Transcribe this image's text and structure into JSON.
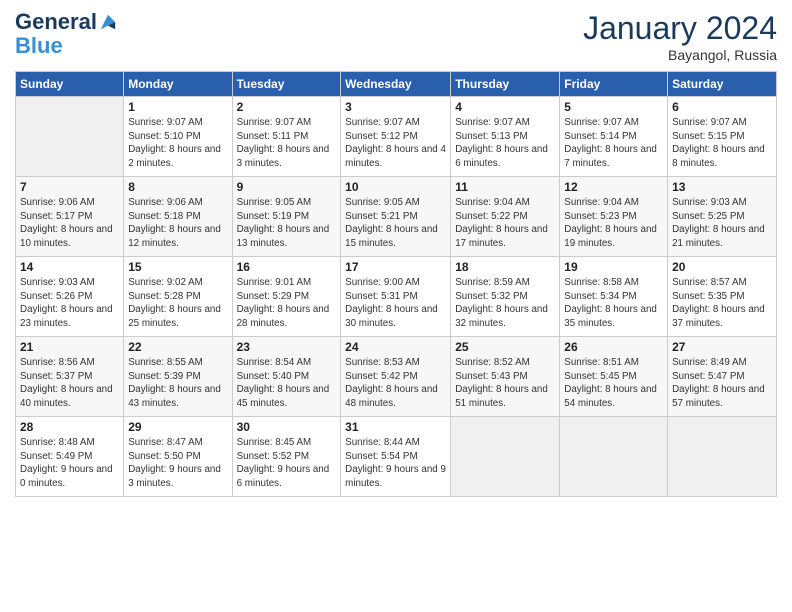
{
  "logo": {
    "line1": "General",
    "line2": "Blue"
  },
  "title": "January 2024",
  "subtitle": "Bayangol, Russia",
  "weekdays": [
    "Sunday",
    "Monday",
    "Tuesday",
    "Wednesday",
    "Thursday",
    "Friday",
    "Saturday"
  ],
  "weeks": [
    [
      {
        "day": null
      },
      {
        "day": 1,
        "sunrise": "9:07 AM",
        "sunset": "5:10 PM",
        "daylight": "8 hours and 2 minutes."
      },
      {
        "day": 2,
        "sunrise": "9:07 AM",
        "sunset": "5:11 PM",
        "daylight": "8 hours and 3 minutes."
      },
      {
        "day": 3,
        "sunrise": "9:07 AM",
        "sunset": "5:12 PM",
        "daylight": "8 hours and 4 minutes."
      },
      {
        "day": 4,
        "sunrise": "9:07 AM",
        "sunset": "5:13 PM",
        "daylight": "8 hours and 6 minutes."
      },
      {
        "day": 5,
        "sunrise": "9:07 AM",
        "sunset": "5:14 PM",
        "daylight": "8 hours and 7 minutes."
      },
      {
        "day": 6,
        "sunrise": "9:07 AM",
        "sunset": "5:15 PM",
        "daylight": "8 hours and 8 minutes."
      }
    ],
    [
      {
        "day": 7,
        "sunrise": "9:06 AM",
        "sunset": "5:17 PM",
        "daylight": "8 hours and 10 minutes."
      },
      {
        "day": 8,
        "sunrise": "9:06 AM",
        "sunset": "5:18 PM",
        "daylight": "8 hours and 12 minutes."
      },
      {
        "day": 9,
        "sunrise": "9:05 AM",
        "sunset": "5:19 PM",
        "daylight": "8 hours and 13 minutes."
      },
      {
        "day": 10,
        "sunrise": "9:05 AM",
        "sunset": "5:21 PM",
        "daylight": "8 hours and 15 minutes."
      },
      {
        "day": 11,
        "sunrise": "9:04 AM",
        "sunset": "5:22 PM",
        "daylight": "8 hours and 17 minutes."
      },
      {
        "day": 12,
        "sunrise": "9:04 AM",
        "sunset": "5:23 PM",
        "daylight": "8 hours and 19 minutes."
      },
      {
        "day": 13,
        "sunrise": "9:03 AM",
        "sunset": "5:25 PM",
        "daylight": "8 hours and 21 minutes."
      }
    ],
    [
      {
        "day": 14,
        "sunrise": "9:03 AM",
        "sunset": "5:26 PM",
        "daylight": "8 hours and 23 minutes."
      },
      {
        "day": 15,
        "sunrise": "9:02 AM",
        "sunset": "5:28 PM",
        "daylight": "8 hours and 25 minutes."
      },
      {
        "day": 16,
        "sunrise": "9:01 AM",
        "sunset": "5:29 PM",
        "daylight": "8 hours and 28 minutes."
      },
      {
        "day": 17,
        "sunrise": "9:00 AM",
        "sunset": "5:31 PM",
        "daylight": "8 hours and 30 minutes."
      },
      {
        "day": 18,
        "sunrise": "8:59 AM",
        "sunset": "5:32 PM",
        "daylight": "8 hours and 32 minutes."
      },
      {
        "day": 19,
        "sunrise": "8:58 AM",
        "sunset": "5:34 PM",
        "daylight": "8 hours and 35 minutes."
      },
      {
        "day": 20,
        "sunrise": "8:57 AM",
        "sunset": "5:35 PM",
        "daylight": "8 hours and 37 minutes."
      }
    ],
    [
      {
        "day": 21,
        "sunrise": "8:56 AM",
        "sunset": "5:37 PM",
        "daylight": "8 hours and 40 minutes."
      },
      {
        "day": 22,
        "sunrise": "8:55 AM",
        "sunset": "5:39 PM",
        "daylight": "8 hours and 43 minutes."
      },
      {
        "day": 23,
        "sunrise": "8:54 AM",
        "sunset": "5:40 PM",
        "daylight": "8 hours and 45 minutes."
      },
      {
        "day": 24,
        "sunrise": "8:53 AM",
        "sunset": "5:42 PM",
        "daylight": "8 hours and 48 minutes."
      },
      {
        "day": 25,
        "sunrise": "8:52 AM",
        "sunset": "5:43 PM",
        "daylight": "8 hours and 51 minutes."
      },
      {
        "day": 26,
        "sunrise": "8:51 AM",
        "sunset": "5:45 PM",
        "daylight": "8 hours and 54 minutes."
      },
      {
        "day": 27,
        "sunrise": "8:49 AM",
        "sunset": "5:47 PM",
        "daylight": "8 hours and 57 minutes."
      }
    ],
    [
      {
        "day": 28,
        "sunrise": "8:48 AM",
        "sunset": "5:49 PM",
        "daylight": "9 hours and 0 minutes."
      },
      {
        "day": 29,
        "sunrise": "8:47 AM",
        "sunset": "5:50 PM",
        "daylight": "9 hours and 3 minutes."
      },
      {
        "day": 30,
        "sunrise": "8:45 AM",
        "sunset": "5:52 PM",
        "daylight": "9 hours and 6 minutes."
      },
      {
        "day": 31,
        "sunrise": "8:44 AM",
        "sunset": "5:54 PM",
        "daylight": "9 hours and 9 minutes."
      },
      {
        "day": null
      },
      {
        "day": null
      },
      {
        "day": null
      }
    ]
  ]
}
